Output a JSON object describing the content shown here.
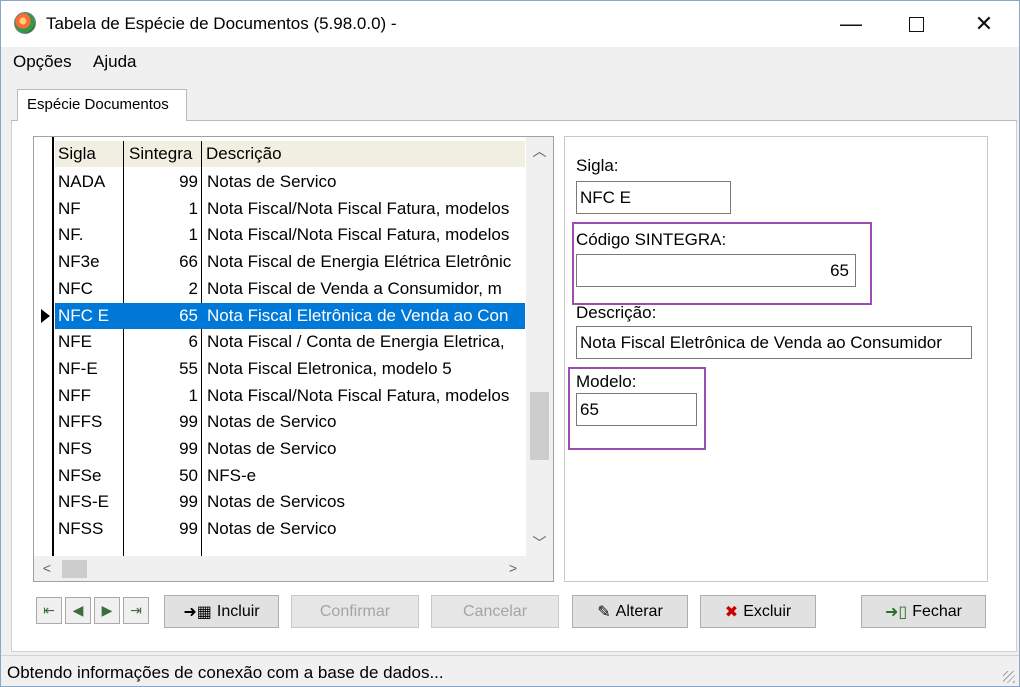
{
  "window": {
    "title": "Tabela de Espécie de Documentos (5.98.0.0) -",
    "minimize": "—",
    "close": "✕"
  },
  "menu": {
    "items": [
      "Opções",
      "Ajuda"
    ]
  },
  "tab": {
    "label": "Espécie Documentos"
  },
  "grid": {
    "columns": [
      "Sigla",
      "Sintegra",
      "Descrição"
    ],
    "selected_index": 5,
    "rows": [
      {
        "sigla": "NADA",
        "sintegra": "99",
        "descricao": "Notas de Servico"
      },
      {
        "sigla": "NF",
        "sintegra": "1",
        "descricao": "Nota Fiscal/Nota Fiscal Fatura, modelos"
      },
      {
        "sigla": "NF.",
        "sintegra": "1",
        "descricao": "Nota Fiscal/Nota Fiscal Fatura, modelos"
      },
      {
        "sigla": "NF3e",
        "sintegra": "66",
        "descricao": "Nota Fiscal de Energia Elétrica Eletrônic"
      },
      {
        "sigla": "NFC",
        "sintegra": "2",
        "descricao": "Nota Fiscal de Venda a Consumidor, m"
      },
      {
        "sigla": "NFC E",
        "sintegra": "65",
        "descricao": "Nota Fiscal Eletrônica de Venda ao Con"
      },
      {
        "sigla": "NFE",
        "sintegra": "6",
        "descricao": "Nota Fiscal / Conta de Energia Eletrica,"
      },
      {
        "sigla": "NF-E",
        "sintegra": "55",
        "descricao": "Nota Fiscal Eletronica, modelo 5"
      },
      {
        "sigla": "NFF",
        "sintegra": "1",
        "descricao": "Nota Fiscal/Nota Fiscal Fatura, modelos"
      },
      {
        "sigla": "NFFS",
        "sintegra": "99",
        "descricao": "Notas de Servico"
      },
      {
        "sigla": "NFS",
        "sintegra": "99",
        "descricao": "Notas de Servico"
      },
      {
        "sigla": "NFSe",
        "sintegra": "50",
        "descricao": "NFS-e"
      },
      {
        "sigla": "NFS-E",
        "sintegra": "99",
        "descricao": "Notas de Servicos"
      },
      {
        "sigla": "NFSS",
        "sintegra": "99",
        "descricao": "Notas de Servico"
      }
    ]
  },
  "form": {
    "sigla_label": "Sigla:",
    "sigla_value": "NFC E",
    "sintegra_label": "Código SINTEGRA:",
    "sintegra_value": "65",
    "descricao_label": "Descrição:",
    "descricao_value": "Nota Fiscal Eletrônica de Venda ao Consumidor",
    "modelo_label": "Modelo:",
    "modelo_value": "65",
    "highlight_color": "#9b4fae"
  },
  "buttons": {
    "incluir": "Incluir",
    "confirmar": "Confirmar",
    "cancelar": "Cancelar",
    "alterar": "Alterar",
    "excluir": "Excluir",
    "fechar": "Fechar"
  },
  "status": {
    "text": "Obtendo informações de conexão com a base de dados..."
  },
  "colors": {
    "selection": "#0078d7",
    "header_bg": "#f1efe2"
  }
}
